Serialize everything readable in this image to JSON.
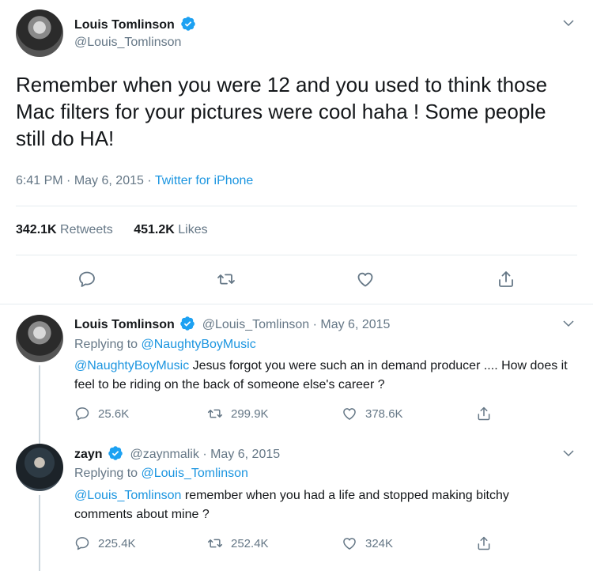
{
  "main_tweet": {
    "author_name": "Louis Tomlinson",
    "author_handle": "@Louis_Tomlinson",
    "text": "Remember when you were 12 and you used to think those Mac filters for your pictures were cool haha ! Some people still do HA!",
    "time": "6:41 PM",
    "sep1": "·",
    "date": "May 6, 2015",
    "sep2": "·",
    "source": "Twitter for iPhone",
    "retweets_count": "342.1K",
    "retweets_label": "Retweets",
    "likes_count": "451.2K",
    "likes_label": "Likes"
  },
  "reply1": {
    "author_name": "Louis Tomlinson",
    "author_handle": "@Louis_Tomlinson",
    "sep": "·",
    "date": "May 6, 2015",
    "replying_label": "Replying to",
    "replying_to": "@NaughtyBoyMusic",
    "mention": "@NaughtyBoyMusic",
    "text": "Jesus forgot you were such an in demand producer .... How does it feel to be riding on the back of someone else's career ?",
    "replies": "25.6K",
    "retweets": "299.9K",
    "likes": "378.6K"
  },
  "reply2": {
    "author_name": "zayn",
    "author_handle": "@zaynmalik",
    "sep": "·",
    "date": "May 6, 2015",
    "replying_label": "Replying to",
    "replying_to": "@Louis_Tomlinson",
    "mention": "@Louis_Tomlinson",
    "text": "remember when you had a life and stopped making bitchy comments about mine ?",
    "replies": "225.4K",
    "retweets": "252.4K",
    "likes": "324K"
  },
  "colors": {
    "link": "#1b95e0",
    "verified": "#1da1f2",
    "muted": "#657786",
    "divider": "#e6ecf0"
  },
  "icons": [
    "verified-badge-icon",
    "chevron-down-icon",
    "reply-icon",
    "retweet-icon",
    "like-icon",
    "share-icon"
  ]
}
